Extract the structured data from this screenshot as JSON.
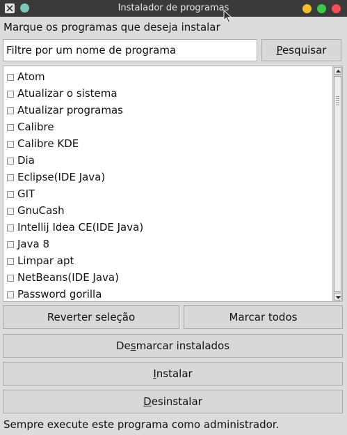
{
  "window": {
    "title": "Instalador de programas"
  },
  "instructions": "Marque os programas que deseja instalar",
  "filter": {
    "placeholder": "Filtre por um nome de programa",
    "value": ""
  },
  "buttons": {
    "search": {
      "prefix": "",
      "accel": "P",
      "rest": "esquisar"
    },
    "revert": "Reverter seleção",
    "mark_all": "Marcar todos",
    "unmark_installed": {
      "prefix": "De",
      "accel": "s",
      "rest": "marcar instalados"
    },
    "install": {
      "prefix": "",
      "accel": "I",
      "rest": "nstalar"
    },
    "uninstall": {
      "prefix": "",
      "accel": "D",
      "rest": "esinstalar"
    }
  },
  "programs": [
    {
      "label": "Atom",
      "checked": false
    },
    {
      "label": "Atualizar o sistema",
      "checked": false
    },
    {
      "label": "Atualizar programas",
      "checked": false
    },
    {
      "label": "Calibre",
      "checked": false
    },
    {
      "label": "Calibre KDE",
      "checked": false
    },
    {
      "label": "Dia",
      "checked": false
    },
    {
      "label": "Eclipse(IDE Java)",
      "checked": false
    },
    {
      "label": "GIT",
      "checked": false
    },
    {
      "label": "GnuCash",
      "checked": false
    },
    {
      "label": "Intellij Idea CE(IDE Java)",
      "checked": false
    },
    {
      "label": "Java 8",
      "checked": false
    },
    {
      "label": "Limpar apt",
      "checked": false
    },
    {
      "label": "NetBeans(IDE Java)",
      "checked": false
    },
    {
      "label": "Password gorilla",
      "checked": false
    }
  ],
  "footer": "Sempre execute este programa como administrador.",
  "colors": {
    "titlebar": "#3a3a3a",
    "minimize": "#f4bf2c",
    "maximize": "#3cc94a",
    "close": "#f0505a",
    "sticky": "#7cc6bd"
  },
  "icons": {
    "app": "x-app-icon",
    "sticky": "sticky-icon",
    "minimize": "minimize-icon",
    "maximize": "maximize-icon",
    "close": "close-icon"
  }
}
